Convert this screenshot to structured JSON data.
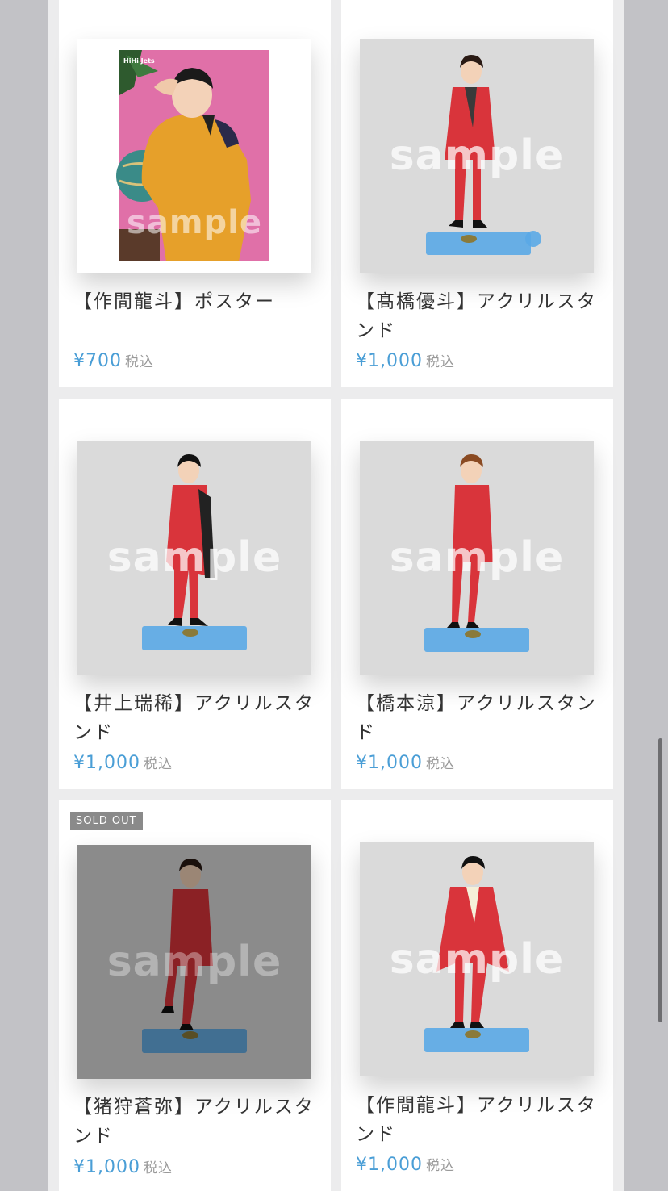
{
  "products": [
    {
      "title": "【作間龍斗】ポスター",
      "price": "¥700",
      "tax": "税込",
      "watermark": "sample",
      "sold_out": "",
      "image_kind": "poster"
    },
    {
      "title": "【髙橋優斗】アクリルスタンド",
      "price": "¥1,000",
      "tax": "税込",
      "watermark": "sample",
      "sold_out": "",
      "image_kind": "acrylic-stand"
    },
    {
      "title": "【井上瑞稀】アクリルスタンド",
      "price": "¥1,000",
      "tax": "税込",
      "watermark": "sample",
      "sold_out": "",
      "image_kind": "acrylic-stand"
    },
    {
      "title": "【橋本涼】アクリルスタンド",
      "price": "¥1,000",
      "tax": "税込",
      "watermark": "sample",
      "sold_out": "",
      "image_kind": "acrylic-stand"
    },
    {
      "title": "【猪狩蒼弥】アクリルスタンド",
      "price": "¥1,000",
      "tax": "税込",
      "watermark": "sample",
      "sold_out": "SOLD OUT",
      "image_kind": "acrylic-stand"
    },
    {
      "title": "【作間龍斗】アクリルスタンド",
      "price": "¥1,000",
      "tax": "税込",
      "watermark": "sample",
      "sold_out": "",
      "image_kind": "acrylic-stand"
    }
  ],
  "poster_logo": "HiHi Jets",
  "colors": {
    "price": "#4a9ed6",
    "tax": "#9a9a9a",
    "title": "#333333",
    "sold_out_badge": "#8a8a8a",
    "page_bg": "#ececed",
    "outer_bg": "#c2c2c6",
    "poster_bg": "#e070a8",
    "shirt": "#e6a02a",
    "costume": "#d9343b",
    "stand_base": "#5aa8e6"
  }
}
